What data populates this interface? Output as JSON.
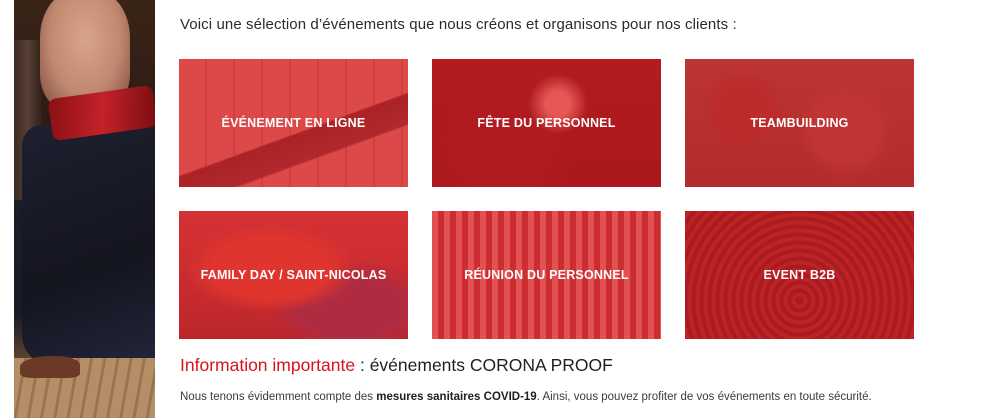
{
  "intro": "Voici une sélection d’événements que nous créons et organisons pour nos clients :",
  "tiles": [
    {
      "label": "Événement en ligne"
    },
    {
      "label": "Fête du personnel"
    },
    {
      "label": "Teambuilding"
    },
    {
      "label": "Family day / Saint-Nicolas"
    },
    {
      "label": "Réunion du personnel"
    },
    {
      "label": "Event B2B"
    }
  ],
  "info": {
    "title_highlight": "Information importante",
    "title_separator": " : ",
    "title_rest": "événements CORONA PROOF",
    "text_before": "Nous tenons évidemment compte des ",
    "text_bold": "mesures sanitaires COVID-19",
    "text_after": ". Ainsi, vous pouvez profiter de vos événements en toute sécurité."
  },
  "colors": {
    "accent": "#d7141c",
    "tile_overlay": "#dc2026"
  }
}
